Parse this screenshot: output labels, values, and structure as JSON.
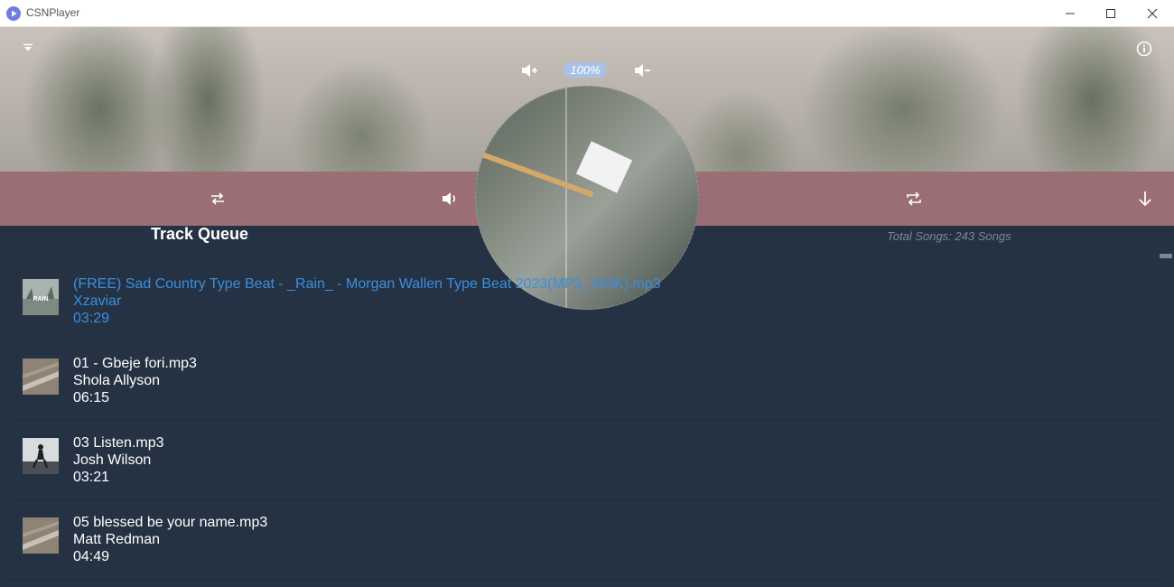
{
  "window": {
    "title": "CSNPlayer",
    "controls": [
      "minimize-icon",
      "maximize-icon",
      "close-icon"
    ]
  },
  "header": {
    "menu_icon": "chevron-down-icon",
    "info_icon": "info-icon",
    "volume_up_icon": "volume-up-icon",
    "volume_down_icon": "volume-down-icon",
    "volume_level": "100%"
  },
  "controls": {
    "shuffle_icon": "shuffle-icon",
    "mute_icon": "volume-icon",
    "file_icon": "file-icon",
    "repeat_icon": "repeat-icon",
    "download_icon": "arrow-down-icon",
    "bar_color": "#9a6e74"
  },
  "queue": {
    "title": "Track Queue",
    "total": "Total Songs: 243 Songs",
    "active_color": "#3a8fe0",
    "tracks": [
      {
        "title": "(FREE) Sad Country Type Beat - _Rain_ - Morgan Wallen Type Beat 2023(MP3_160K).mp3",
        "artist": "Xzaviar",
        "duration": "03:29",
        "active": true,
        "thumb_label": "RAIN"
      },
      {
        "title": "01 - Gbeje fori.mp3",
        "artist": "Shola Allyson",
        "duration": "06:15",
        "active": false
      },
      {
        "title": "03 Listen.mp3",
        "artist": "Josh Wilson",
        "duration": "03:21",
        "active": false
      },
      {
        "title": "05 blessed be your name.mp3",
        "artist": "Matt Redman",
        "duration": "04:49",
        "active": false
      }
    ]
  }
}
